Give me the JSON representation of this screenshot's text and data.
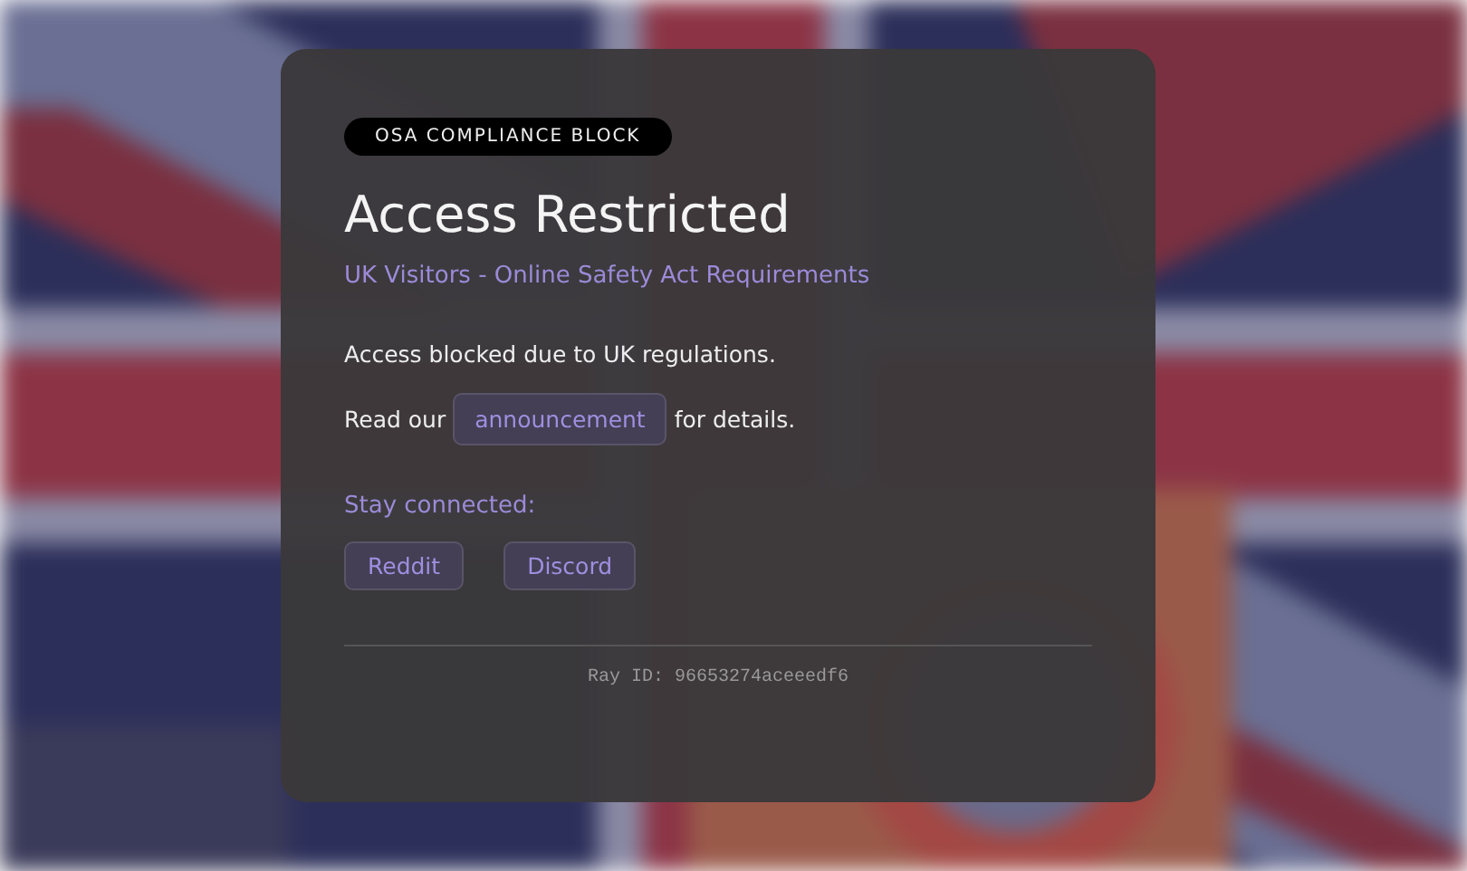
{
  "card": {
    "badge": "OSA COMPLIANCE BLOCK",
    "title": "Access Restricted",
    "subtitle": "UK Visitors - Online Safety Act Requirements",
    "message": "Access blocked due to UK regulations.",
    "notice": {
      "before": "Read our",
      "link": "announcement",
      "after": "for details."
    },
    "social": {
      "heading": "Stay connected:",
      "links": [
        "Reddit",
        "Discord"
      ]
    },
    "ray_id": "Ray ID: 96653274aceeedf6"
  }
}
